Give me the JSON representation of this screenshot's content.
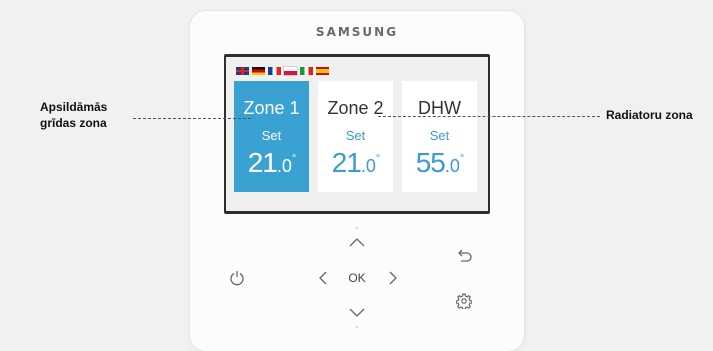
{
  "brand": "SAMSUNG",
  "flags": [
    "uk-flag-icon",
    "germany-flag-icon",
    "france-flag-icon",
    "poland-flag-icon",
    "italy-flag-icon",
    "spain-flag-icon"
  ],
  "zones": [
    {
      "name": "Zone 1",
      "set_label": "Set",
      "temp_int": "21",
      "temp_frac": ".0",
      "temp_unit": "°",
      "active": true
    },
    {
      "name": "Zone 2",
      "set_label": "Set",
      "temp_int": "21",
      "temp_frac": ".0",
      "temp_unit": "°",
      "active": false
    },
    {
      "name": "DHW",
      "set_label": "Set",
      "temp_int": "55",
      "temp_frac": ".0",
      "temp_unit": "°",
      "active": false
    }
  ],
  "buttons": {
    "ok_label": "OK"
  },
  "icons": {
    "power": "power-icon",
    "up": "chevron-up-icon",
    "down": "chevron-down-icon",
    "left": "chevron-left-icon",
    "right": "chevron-right-icon",
    "back": "back-arrow-icon",
    "settings": "gear-icon"
  },
  "callouts": {
    "left_line1": "Apsildāmās",
    "left_line2": "grīdas zona",
    "right": "Radiatoru zona"
  },
  "colors": {
    "active_tile": "#3aa1d3",
    "set_text": "#3a9ccf",
    "background": "#f1f1f1"
  }
}
